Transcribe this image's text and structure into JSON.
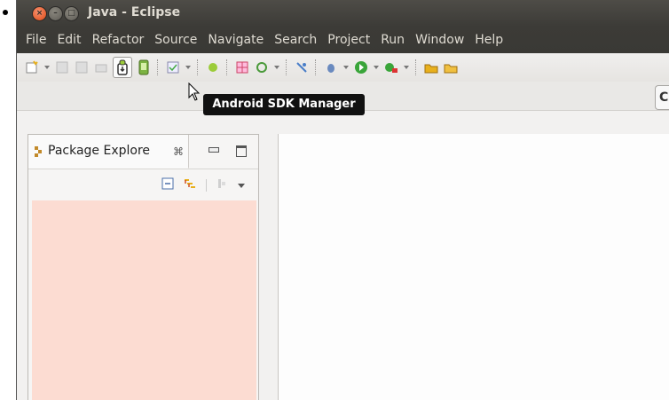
{
  "window": {
    "title": "Java - Eclipse",
    "controls": [
      "close",
      "minimize",
      "maximize"
    ]
  },
  "menu": [
    "File",
    "Edit",
    "Refactor",
    "Source",
    "Navigate",
    "Search",
    "Project",
    "Run",
    "Window",
    "Help"
  ],
  "toolbar": {
    "tooltip": "Android SDK Manager"
  },
  "perspective": {
    "label": "C"
  },
  "package_explorer": {
    "tab_label": "Package Explore",
    "close_glyph": "⌘"
  },
  "colors": {
    "titlebar": "#3c3b37",
    "menu_text": "#dfdbd2",
    "close_button": "#df4a16",
    "package_body": "#fcdcd2"
  }
}
